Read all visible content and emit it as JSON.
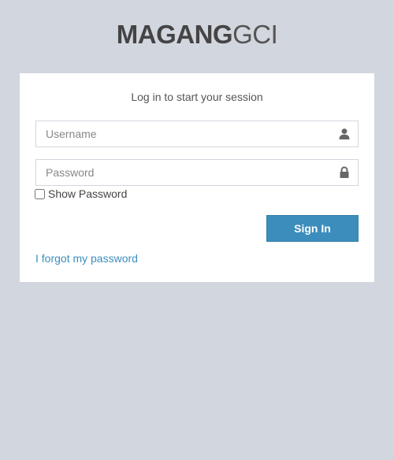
{
  "logo": {
    "bold": "MAGANG",
    "light": "GCI"
  },
  "login": {
    "message": "Log in to start your session",
    "username_placeholder": "Username",
    "password_placeholder": "Password",
    "show_password_label": "Show Password",
    "sign_in_label": "Sign In",
    "forgot_password_label": "I forgot my password"
  },
  "icons": {
    "username": "user-icon",
    "password": "lock-icon"
  },
  "colors": {
    "background": "#d2d6de",
    "primary": "#3c8dbc",
    "link": "#3c8dbc",
    "box": "#ffffff"
  }
}
